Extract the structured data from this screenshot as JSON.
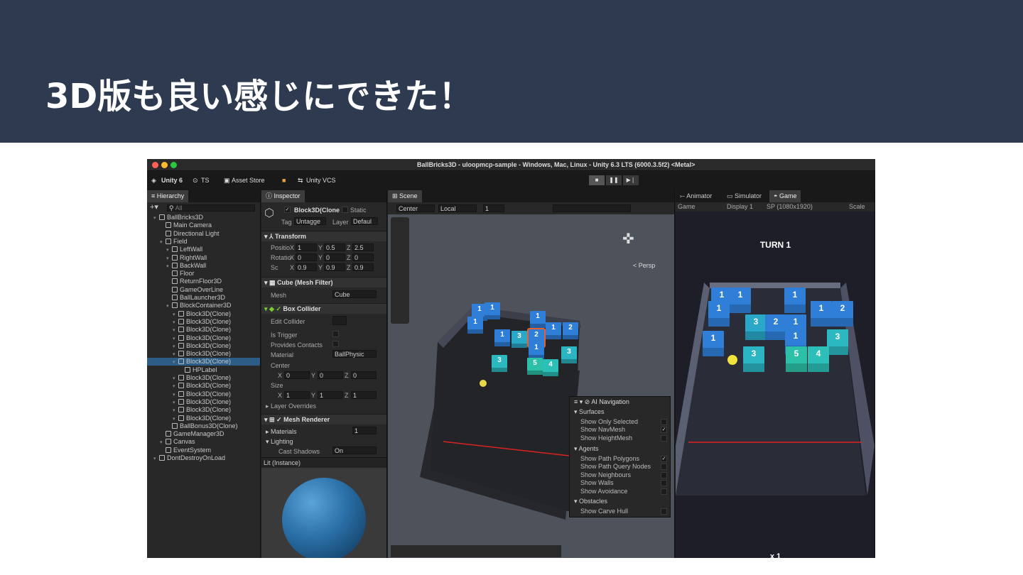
{
  "slide": {
    "title": "3D版も良い感じにできた！"
  },
  "window": {
    "title": "BallBricks3D - uloopmcp-sample - Windows, Mac, Linux - Unity 6.3 LTS (6000.3.5f2) <Metal>"
  },
  "toolbar": {
    "unity": "Unity 6",
    "account": "TS",
    "asset_store": "Asset Store",
    "vcs": "Unity VCS"
  },
  "hierarchy": {
    "tab": "Hierarchy",
    "search": "All",
    "items": [
      "BallBricks3D",
      "Main Camera",
      "Directional Light",
      "Field",
      "LeftWall",
      "RightWall",
      "BackWall",
      "Floor",
      "ReturnFloor3D",
      "GameOverLine",
      "BallLauncher3D",
      "BlockContainer3D",
      "Block3D(Clone)",
      "Block3D(Clone)",
      "Block3D(Clone)",
      "Block3D(Clone)",
      "Block3D(Clone)",
      "Block3D(Clone)",
      "Block3D(Clone)",
      "HPLabel",
      "Block3D(Clone)",
      "Block3D(Clone)",
      "Block3D(Clone)",
      "Block3D(Clone)",
      "Block3D(Clone)",
      "Block3D(Clone)",
      "BallBonus3D(Clone)",
      "GameManager3D",
      "Canvas",
      "EventSystem",
      "DontDestroyOnLoad"
    ]
  },
  "inspector": {
    "tab": "Inspector",
    "object": "Block3D(Clone",
    "static": "Static",
    "tag_label": "Tag",
    "tag": "Untagge",
    "layer_label": "Layer",
    "layer": "Defaul",
    "transform": {
      "title": "Transform",
      "position": [
        "1",
        "0.5",
        "2.5"
      ],
      "rotation": [
        "0",
        "0",
        "0"
      ],
      "scale": [
        "0.9",
        "0.9",
        "0.9"
      ],
      "pos_label": "Positio",
      "rot_label": "Rotatio",
      "scale_label": "Sc"
    },
    "mesh_filter": {
      "title": "Cube (Mesh Filter)",
      "mesh_label": "Mesh",
      "mesh": "Cube"
    },
    "box_collider": {
      "title": "Box Collider",
      "edit": "Edit Collider",
      "trigger": "Is Trigger",
      "contacts": "Provides Contacts",
      "material_label": "Material",
      "material": "BallPhysic",
      "center_label": "Center",
      "center": [
        "0",
        "0",
        "0"
      ],
      "size_label": "Size",
      "size": [
        "1",
        "1",
        "1"
      ],
      "overrides": "Layer Overrides"
    },
    "mesh_renderer": {
      "title": "Mesh Renderer",
      "materials": "Materials",
      "materials_count": "1",
      "lighting": "Lighting",
      "shadows_label": "Cast Shadows",
      "shadows": "On"
    },
    "preview": {
      "title": "Lit (Instance)"
    }
  },
  "scene": {
    "tab": "Scene",
    "pivot": "Center",
    "space": "Local",
    "grid": "1",
    "persp": "< Persp",
    "blocks": [
      {
        "v": "1",
        "c": "#2f7fd8"
      },
      {
        "v": "1",
        "c": "#2f7fd8"
      },
      {
        "v": "1",
        "c": "#2f7fd8"
      },
      {
        "v": "1",
        "c": "#2f7fd8"
      },
      {
        "v": "1",
        "c": "#2f7fd8"
      },
      {
        "v": "3",
        "c": "#2aa8c8"
      },
      {
        "v": "2",
        "c": "#2f7fd8"
      },
      {
        "v": "1",
        "c": "#2f7fd8"
      },
      {
        "v": "2",
        "c": "#2f7fd8"
      },
      {
        "v": "1",
        "c": "#2f7fd8"
      },
      {
        "v": "3",
        "c": "#2bb5c2"
      },
      {
        "v": "3",
        "c": "#2bb8c0"
      },
      {
        "v": "5",
        "c": "#2cc0a8"
      },
      {
        "v": "4",
        "c": "#2bbfb8"
      }
    ]
  },
  "ai_nav": {
    "title": "AI Navigation",
    "surfaces": "Surfaces",
    "s_items": [
      "Show Only Selected",
      "Show NavMesh",
      "Show HeightMesh"
    ],
    "agents": "Agents",
    "a_items": [
      "Show Path Polygons",
      "Show Path Query Nodes",
      "Show Neighbours",
      "Show Walls",
      "Show Avoidance"
    ],
    "obstacles": "Obstacles",
    "o_items": [
      "Show Carve Hull"
    ]
  },
  "game": {
    "tabs": [
      "Animator",
      "Simulator",
      "Game"
    ],
    "mode": "Game",
    "display": "Display 1",
    "res": "SP (1080x1920)",
    "scale": "Scale",
    "turn": "TURN 1",
    "multiplier": "x 1",
    "blocks": [
      {
        "v": "1",
        "c": "#2f7fd8"
      },
      {
        "v": "1",
        "c": "#2f7fd8"
      },
      {
        "v": "1",
        "c": "#2f7fd8"
      },
      {
        "v": "1",
        "c": "#2f7fd8"
      },
      {
        "v": "1",
        "c": "#2f7fd8"
      },
      {
        "v": "2",
        "c": "#2f7fd8"
      },
      {
        "v": "1",
        "c": "#2f7fd8"
      },
      {
        "v": "3",
        "c": "#2aa8c8"
      },
      {
        "v": "2",
        "c": "#2f7fd8"
      },
      {
        "v": "1",
        "c": "#2f7fd8"
      },
      {
        "v": "1",
        "c": "#2f7fd8"
      },
      {
        "v": "3",
        "c": "#2bb8c0"
      },
      {
        "v": "3",
        "c": "#2bb5c2"
      },
      {
        "v": "5",
        "c": "#2cc0a8"
      },
      {
        "v": "4",
        "c": "#2bbfb8"
      }
    ]
  }
}
